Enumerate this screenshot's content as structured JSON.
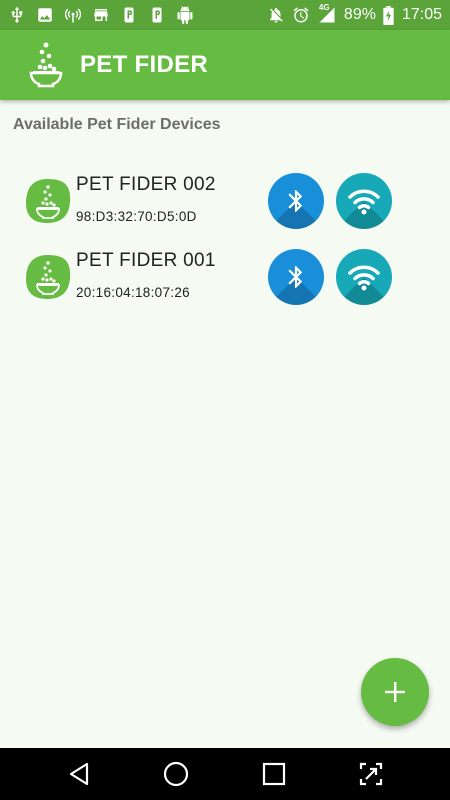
{
  "status_bar": {
    "left_icons": [
      "usb-icon",
      "image-icon",
      "hotspot-icon",
      "store-icon",
      "p-app-icon",
      "p-app-icon",
      "android-icon"
    ],
    "battery": "89%",
    "time": "17:05",
    "network": "4G"
  },
  "app_bar": {
    "title": "PET FIDER"
  },
  "section_title": "Available Pet Fider Devices",
  "devices": [
    {
      "name": "PET FIDER 002",
      "mac": "98:D3:32:70:D5:0D"
    },
    {
      "name": "PET FIDER 001",
      "mac": "20:16:04:18:07:26"
    }
  ],
  "colors": {
    "primary": "#66bb42",
    "primary_dark": "#5aa43a",
    "bluetooth": "#1a8fd9",
    "wifi": "#17a9b7",
    "background": "#f5faf3"
  }
}
